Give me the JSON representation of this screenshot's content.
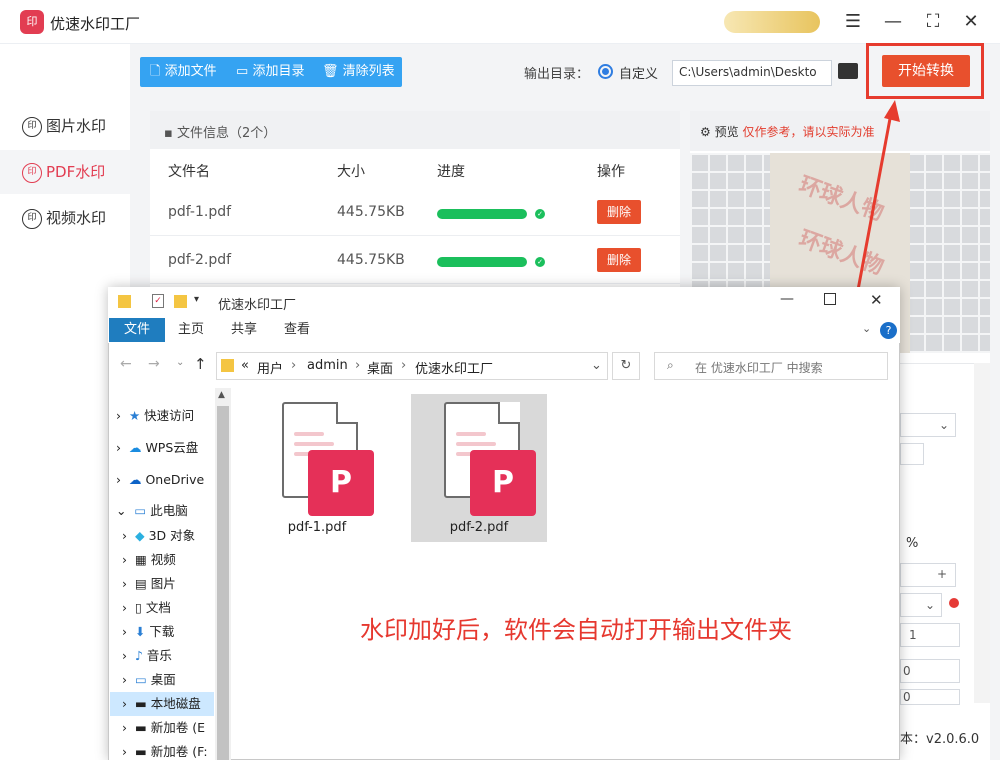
{
  "app": {
    "title": "优速水印工厂",
    "logo_text": "印",
    "version_label": "本：v2.0.6.0",
    "window_buttons": [
      "menu-icon",
      "minimize-icon",
      "maximize-icon",
      "close-icon"
    ]
  },
  "sidebar": {
    "items": [
      {
        "label": "图片水印",
        "icon": "印"
      },
      {
        "label": "PDF水印",
        "icon": "印",
        "active": true
      },
      {
        "label": "视频水印",
        "icon": "印"
      }
    ]
  },
  "toolbar": {
    "add_file": "添加文件",
    "add_folder": "添加目录",
    "clear_list": "清除列表"
  },
  "output": {
    "label": "输出目录：",
    "option": "自定义",
    "path": "C:\\Users\\admin\\Deskto",
    "start_button": "开始转换"
  },
  "file_list": {
    "header": "文件信息（2个）",
    "columns": [
      "文件名",
      "大小",
      "进度",
      "操作"
    ],
    "rows": [
      {
        "name": "pdf-1.pdf",
        "size": "445.75KB",
        "progress": 1.0,
        "action": "删除"
      },
      {
        "name": "pdf-2.pdf",
        "size": "445.75KB",
        "progress": 1.0,
        "action": "删除"
      }
    ]
  },
  "preview": {
    "title": "预览",
    "note": "仅作参考，请以实际为准",
    "watermark_text": "环球人物"
  },
  "settings": {
    "percent": "%",
    "plus": "+",
    "stepper_value": "1",
    "zero_a": "0",
    "zero_b": "0"
  },
  "explorer": {
    "title": "优速水印工厂",
    "ribbon_tabs": [
      "文件",
      "主页",
      "共享",
      "查看"
    ],
    "address": [
      "«",
      "用户",
      "admin",
      "桌面",
      "优速水印工厂"
    ],
    "search_placeholder": "在 优速水印工厂 中搜索",
    "nav": [
      {
        "label": "快速访问",
        "icon": "star-icon"
      },
      {
        "label": "WPS云盘",
        "icon": "cloud-icon"
      },
      {
        "label": "OneDrive",
        "icon": "cloud-icon"
      },
      {
        "label": "此电脑",
        "icon": "computer-icon"
      },
      {
        "label": "3D 对象",
        "icon": "cube-icon"
      },
      {
        "label": "视频",
        "icon": "video-icon"
      },
      {
        "label": "图片",
        "icon": "image-icon"
      },
      {
        "label": "文档",
        "icon": "document-icon"
      },
      {
        "label": "下载",
        "icon": "download-icon"
      },
      {
        "label": "音乐",
        "icon": "music-icon"
      },
      {
        "label": "桌面",
        "icon": "desktop-icon"
      },
      {
        "label": "本地磁盘",
        "icon": "drive-icon"
      },
      {
        "label": "新加卷 (E",
        "icon": "drive-icon"
      },
      {
        "label": "新加卷 (F:",
        "icon": "drive-icon"
      }
    ],
    "files": [
      "pdf-1.pdf",
      "pdf-2.pdf"
    ]
  },
  "annotation": "水印加好后，软件会自动打开输出文件夹",
  "colors": {
    "accent": "#e23d52",
    "toolbar": "#35a3f2",
    "start": "#e8502d",
    "progress": "#1bbf5c",
    "annotation": "#e6382f"
  }
}
